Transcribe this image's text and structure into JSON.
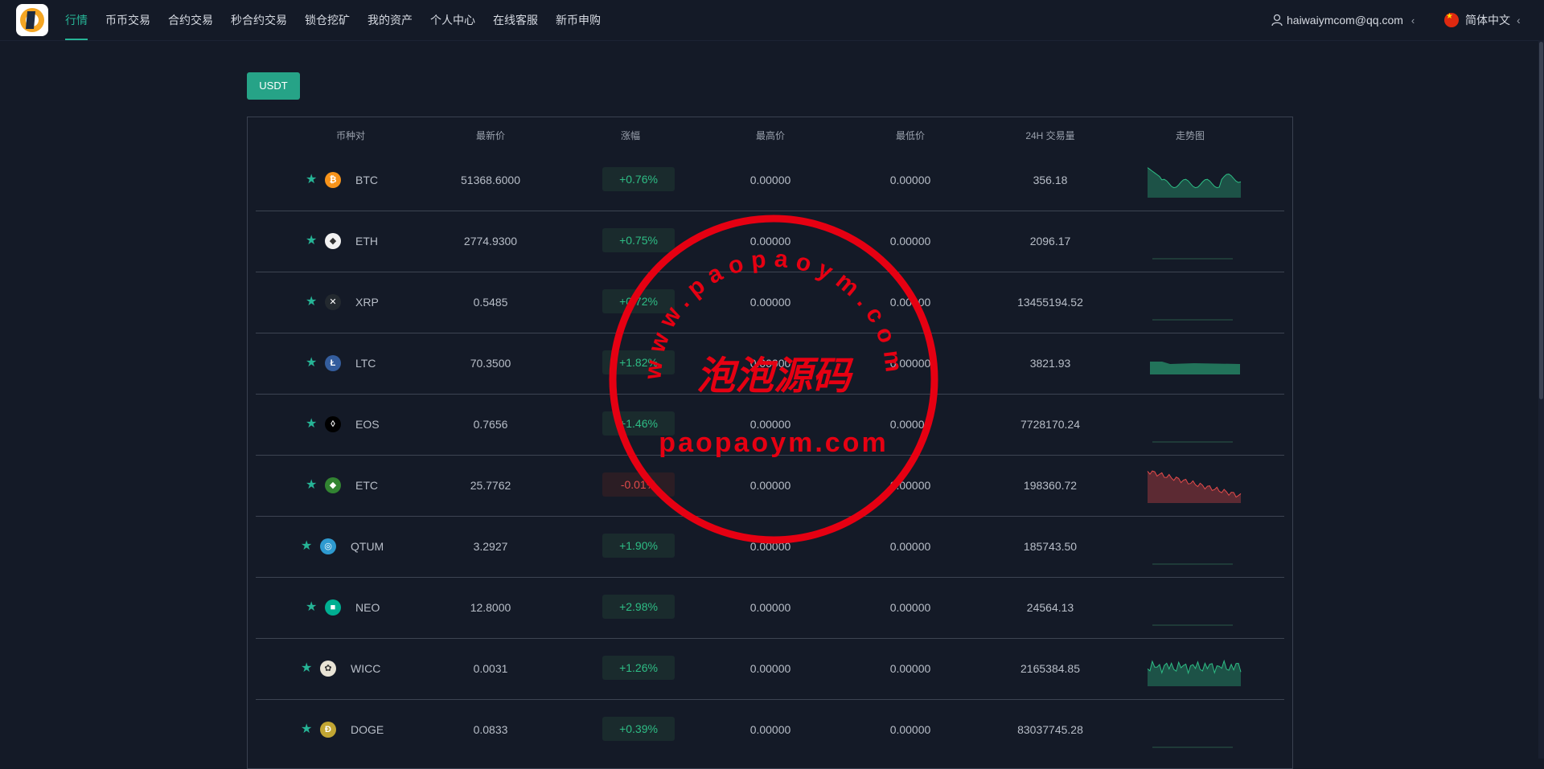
{
  "nav": {
    "items": [
      "行情",
      "币币交易",
      "合约交易",
      "秒合约交易",
      "锁仓挖矿",
      "我的资产",
      "个人中心",
      "在线客服",
      "新币申购"
    ],
    "active_index": 0
  },
  "user": {
    "email": "haiwaiymcom@qq.com",
    "chevron": "‹"
  },
  "language": {
    "label": "简体中文",
    "chevron": "‹"
  },
  "market_tab": "USDT",
  "table": {
    "headers": [
      "币种对",
      "最新价",
      "涨幅",
      "最高价",
      "最低价",
      "24H 交易量",
      "走势图"
    ],
    "rows": [
      {
        "symbol": "BTC",
        "price": "51368.6000",
        "change": "+0.76%",
        "high": "0.00000",
        "low": "0.00000",
        "volume": "356.18",
        "trend": "up",
        "icon": "btc-icon",
        "icon_color": "#f7931a"
      },
      {
        "symbol": "ETH",
        "price": "2774.9300",
        "change": "+0.75%",
        "high": "0.00000",
        "low": "0.00000",
        "volume": "2096.17",
        "trend": "up",
        "icon": "eth-icon",
        "icon_color": "#f2f2f2"
      },
      {
        "symbol": "XRP",
        "price": "0.5485",
        "change": "+0.72%",
        "high": "0.00000",
        "low": "0.00000",
        "volume": "13455194.52",
        "trend": "up",
        "icon": "xrp-icon",
        "icon_color": "#23292f"
      },
      {
        "symbol": "LTC",
        "price": "70.3500",
        "change": "+1.82%",
        "high": "0.00000",
        "low": "0.00000",
        "volume": "3821.93",
        "trend": "up",
        "icon": "ltc-icon",
        "icon_color": "#345d9d"
      },
      {
        "symbol": "EOS",
        "price": "0.7656",
        "change": "+1.46%",
        "high": "0.00000",
        "low": "0.00000",
        "volume": "7728170.24",
        "trend": "up",
        "icon": "eos-icon",
        "icon_color": "#000000"
      },
      {
        "symbol": "ETC",
        "price": "25.7762",
        "change": "-0.01%",
        "high": "0.00000",
        "low": "0.00000",
        "volume": "198360.72",
        "trend": "down",
        "icon": "etc-icon",
        "icon_color": "#328432"
      },
      {
        "symbol": "QTUM",
        "price": "3.2927",
        "change": "+1.90%",
        "high": "0.00000",
        "low": "0.00000",
        "volume": "185743.50",
        "trend": "up",
        "icon": "qtum-icon",
        "icon_color": "#2e9ad0"
      },
      {
        "symbol": "NEO",
        "price": "12.8000",
        "change": "+2.98%",
        "high": "0.00000",
        "low": "0.00000",
        "volume": "24564.13",
        "trend": "up",
        "icon": "neo-icon",
        "icon_color": "#00af92"
      },
      {
        "symbol": "WICC",
        "price": "0.0031",
        "change": "+1.26%",
        "high": "0.00000",
        "low": "0.00000",
        "volume": "2165384.85",
        "trend": "up",
        "icon": "wicc-icon",
        "icon_color": "#e9e4d6"
      },
      {
        "symbol": "DOGE",
        "price": "0.0833",
        "change": "+0.39%",
        "high": "0.00000",
        "low": "0.00000",
        "volume": "83037745.28",
        "trend": "up",
        "icon": "doge-icon",
        "icon_color": "#c2a633"
      }
    ]
  },
  "watermark": {
    "url_text": "www.paopaoym.com",
    "cn_text": "泡泡源码",
    "bottom_text": "paopaoym.com"
  },
  "colors": {
    "accent": "#26b496",
    "up": "#2ebd85",
    "down": "#e24a4a",
    "stamp": "#e60012"
  }
}
